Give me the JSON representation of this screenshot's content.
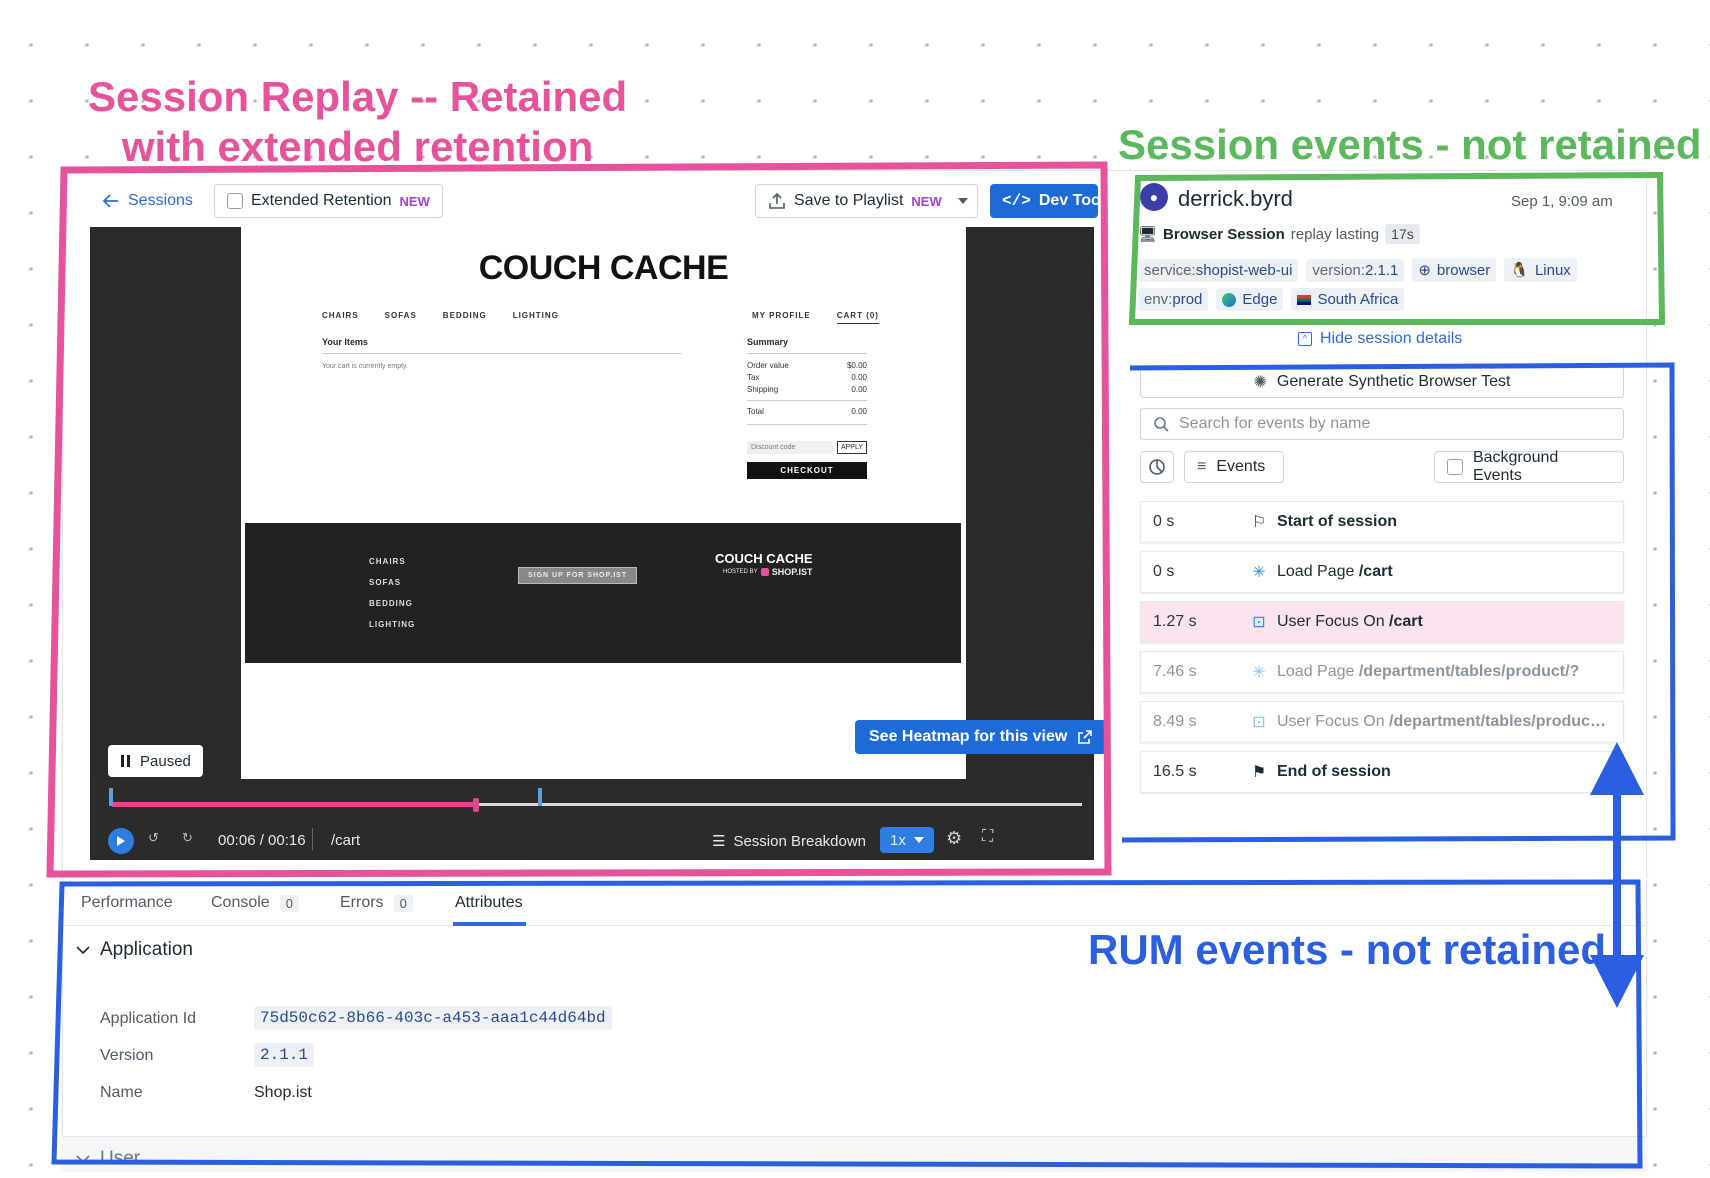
{
  "annotations": {
    "session_replay_line1": "Session Replay -- Retained",
    "session_replay_line2": "with extended retention",
    "session_events": "Session events - not retained",
    "rum_events": "RUM events - not retained"
  },
  "colors": {
    "pink": "#e6539b",
    "green": "#5cb85c",
    "blue": "#2b5fe0",
    "primary": "#1e6bd8"
  },
  "header": {
    "sessions_label": "Sessions",
    "extended_retention_label": "Extended Retention",
    "extended_retention_badge": "NEW",
    "save_playlist_label": "Save to Playlist",
    "save_playlist_badge": "NEW",
    "dev_tools_label": "Dev Tools"
  },
  "shop": {
    "title": "COUCH CACHE",
    "nav": [
      "CHAIRS",
      "SOFAS",
      "BEDDING",
      "LIGHTING"
    ],
    "account": [
      "MY PROFILE",
      "CART (0)"
    ],
    "your_items": "Your Items",
    "cart_empty": "Your cart is currently empty.",
    "summary": "Summary",
    "summary_rows": [
      {
        "label": "Order value",
        "value": "$0.00"
      },
      {
        "label": "Tax",
        "value": "0.00"
      },
      {
        "label": "Shipping",
        "value": "0.00"
      },
      {
        "label": "Total",
        "value": "0.00"
      }
    ],
    "discount_placeholder": "Discount code",
    "apply_label": "APPLY",
    "checkout_label": "CHECKOUT",
    "footer_nav": [
      "CHAIRS",
      "SOFAS",
      "BEDDING",
      "LIGHTING"
    ],
    "signup_label": "SIGN UP FOR SHOP.IST",
    "footer_brand": "COUCH CACHE",
    "footer_hosted_prefix": "HOSTED BY",
    "footer_hosted_brand": "SHOP.IST"
  },
  "player": {
    "heatmap_label": "See Heatmap for this view",
    "paused_label": "Paused",
    "time": "00:06 / 00:16",
    "path": "/cart",
    "breakdown_label": "Session Breakdown",
    "speed": "1x",
    "progress_fraction": 0.375
  },
  "session": {
    "user": "derrick.byrd",
    "date": "Sep 1, 9:09 am",
    "type_label": "Browser Session",
    "replay_text": "replay lasting",
    "duration": "17s",
    "tags": [
      {
        "key": "service:",
        "value": "shopist-web-ui"
      },
      {
        "key": "version:",
        "value": "2.1.1"
      }
    ],
    "browser_tag": "browser",
    "os_tag": "Linux",
    "env_key": "env:",
    "env_value": "prod",
    "browser_name": "Edge",
    "country": "South Africa",
    "hide_details": "Hide session details",
    "synthetic_label": "Generate Synthetic Browser Test",
    "search_placeholder": "Search for events by name",
    "events_filter": "Events",
    "background_events": "Background Events"
  },
  "events": [
    {
      "time": "0 s",
      "label": "Start of session",
      "path": "",
      "icon": "flag-outline-icon"
    },
    {
      "time": "0 s",
      "label": "Load Page",
      "path": "/cart",
      "icon": "loading-icon"
    },
    {
      "time": "1.27 s",
      "label": "User Focus On",
      "path": "/cart",
      "icon": "focus-icon"
    },
    {
      "time": "7.46 s",
      "label": "Load Page",
      "path": "/department/tables/product/?",
      "icon": "loading-icon"
    },
    {
      "time": "8.49 s",
      "label": "User Focus On",
      "path": "/department/tables/produc…",
      "icon": "focus-icon"
    },
    {
      "time": "16.5 s",
      "label": "End of session",
      "path": "",
      "icon": "flag-filled-icon"
    }
  ],
  "tabs": [
    {
      "label": "Performance"
    },
    {
      "label": "Console",
      "count": "0"
    },
    {
      "label": "Errors",
      "count": "0"
    },
    {
      "label": "Attributes"
    }
  ],
  "attributes": {
    "section": "Application",
    "rows": [
      {
        "label": "Application Id",
        "value": "75d50c62-8b66-403c-a453-aaa1c44d64bd"
      },
      {
        "label": "Version",
        "value": "2.1.1"
      },
      {
        "label": "Name",
        "value": "Shop.ist"
      }
    ],
    "next_section": "User"
  }
}
